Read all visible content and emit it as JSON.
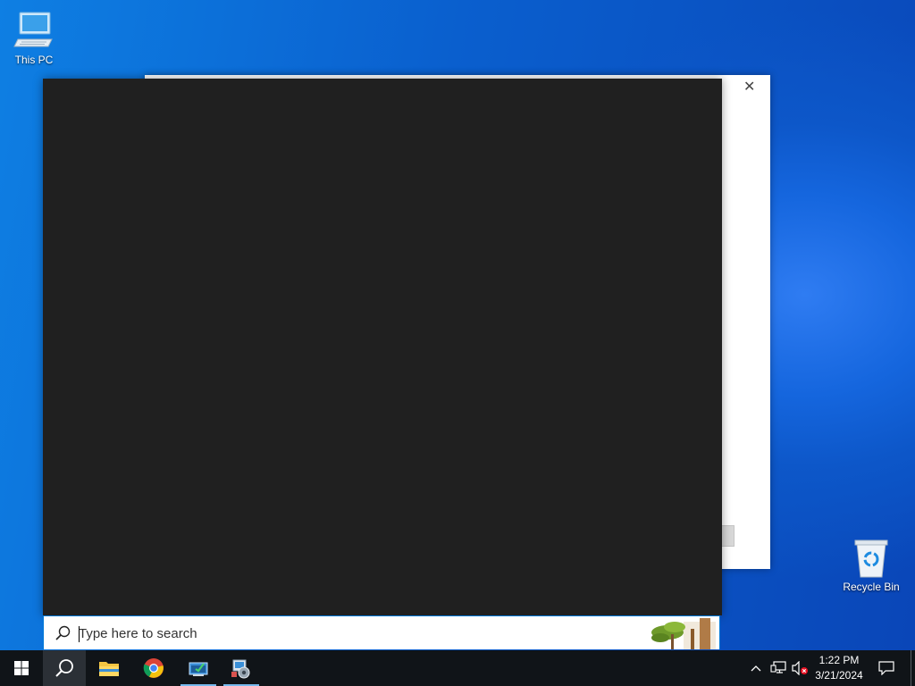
{
  "desktop": {
    "icons": [
      {
        "label": "This PC",
        "icon": "computer-icon"
      },
      {
        "label": "Recycle Bin",
        "icon": "recycle-bin-icon"
      }
    ]
  },
  "dialog": {
    "close_glyph": "✕"
  },
  "search": {
    "placeholder": "Type here to search",
    "value": ""
  },
  "taskbar": {
    "buttons": [
      {
        "name": "start",
        "icon": "windows-logo-icon"
      },
      {
        "name": "search",
        "icon": "search-icon",
        "active": true
      },
      {
        "name": "file-explorer",
        "icon": "folder-icon"
      },
      {
        "name": "chrome",
        "icon": "chrome-icon"
      },
      {
        "name": "app-1",
        "icon": "app-window-icon",
        "running": true
      },
      {
        "name": "app-2",
        "icon": "installer-icon",
        "running": true
      }
    ],
    "tray": {
      "time": "1:22 PM",
      "date": "3/21/2024",
      "icons": [
        "chevron-up-icon",
        "network-icon",
        "volume-muted-icon",
        "notification-icon"
      ]
    }
  },
  "colors": {
    "taskbar_bg": "#101418",
    "search_panel_bg": "#202020",
    "accent": "#0078d7"
  }
}
